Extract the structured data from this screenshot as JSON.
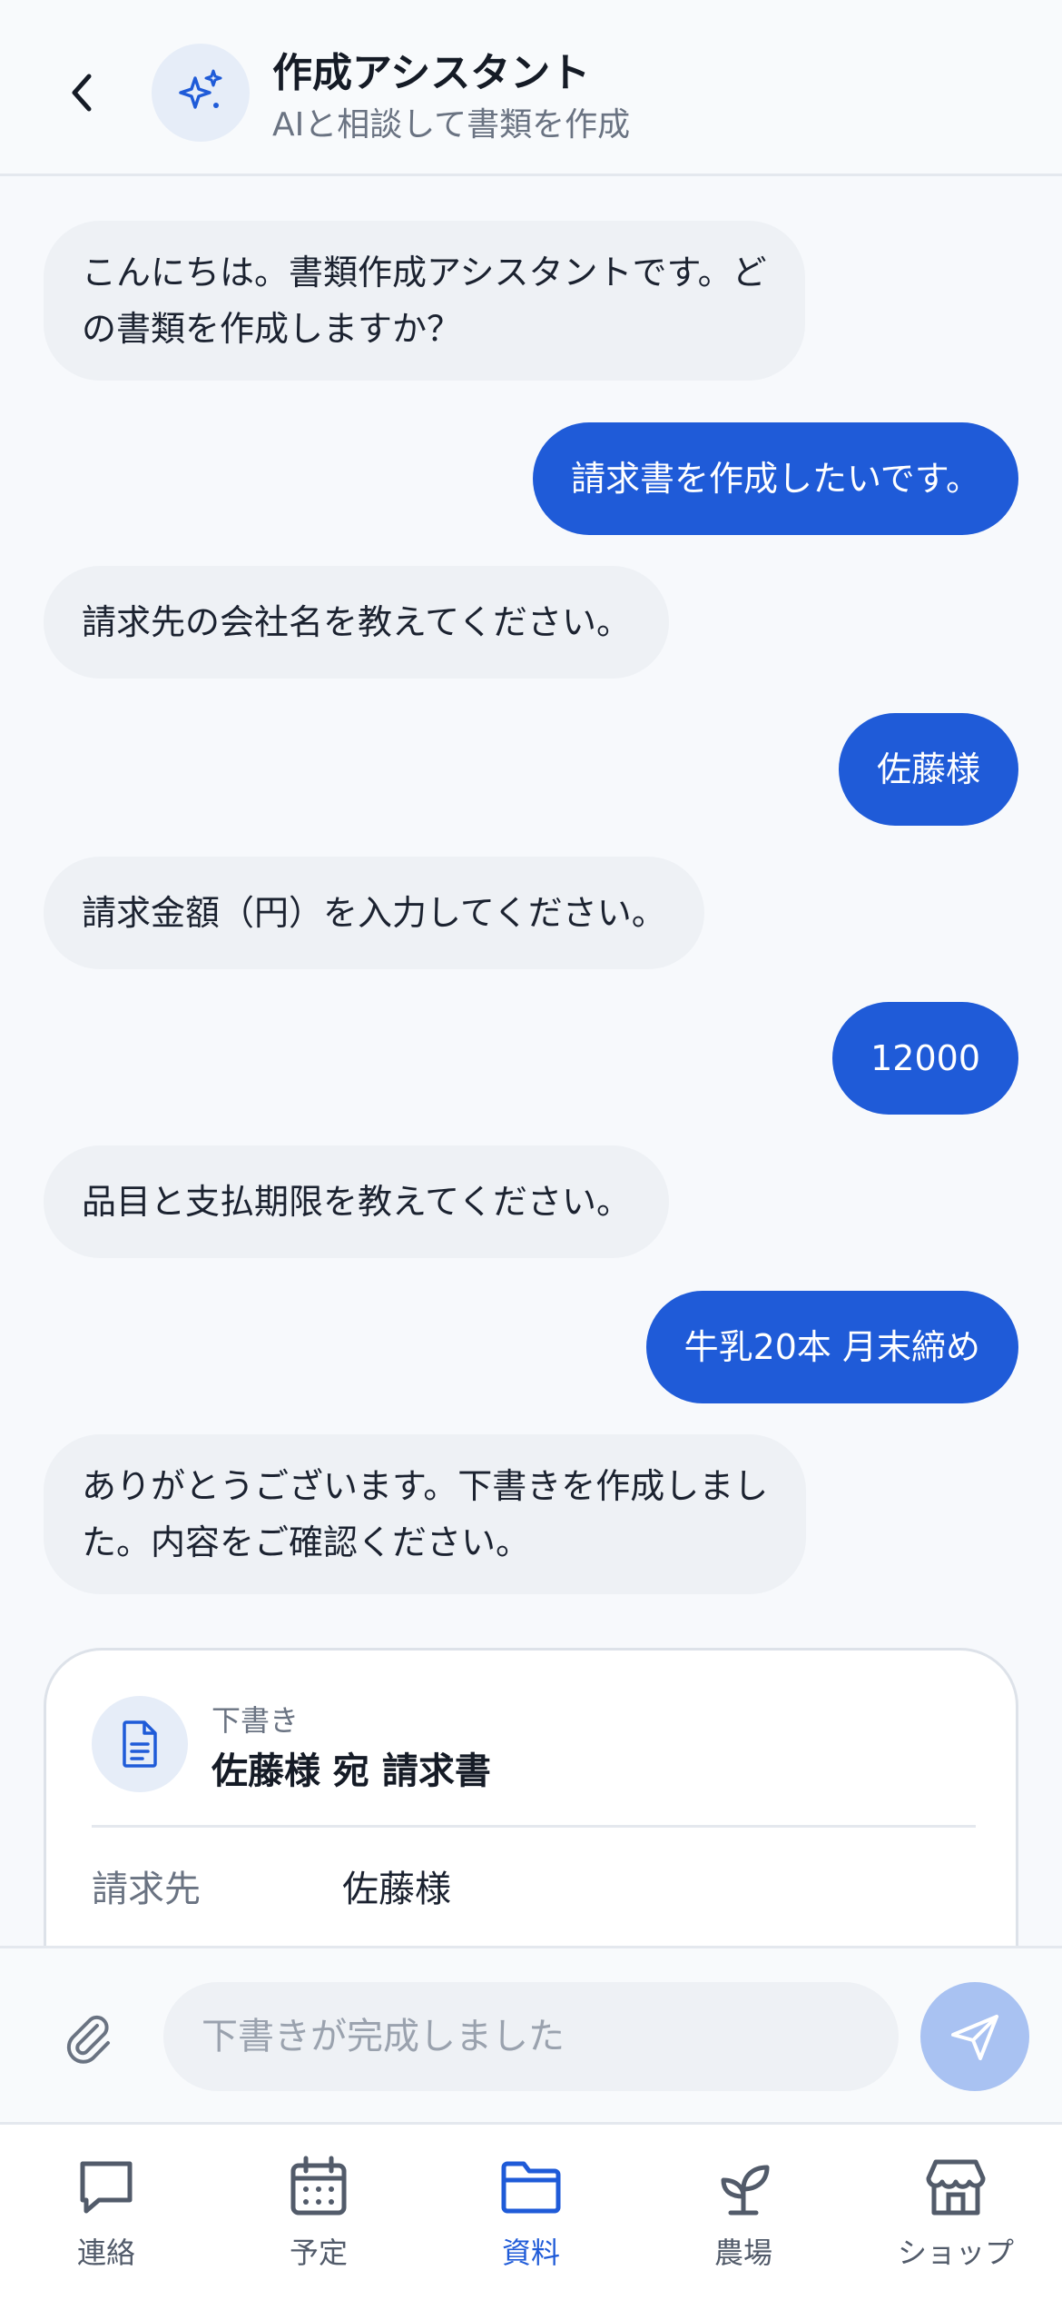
{
  "header": {
    "title": "作成アシスタント",
    "subtitle": "AIと相談して書類を作成",
    "back_icon": "chevron-left-icon",
    "avatar_icon": "sparkles-icon"
  },
  "messages": [
    {
      "role": "bot",
      "text_lines": [
        "こんにちは。書類作成アシスタントです。ど",
        "の書類を作成しますか？"
      ]
    },
    {
      "role": "user",
      "text": "請求書を作成したいです。"
    },
    {
      "role": "bot",
      "text": "請求先の会社名を教えてください。"
    },
    {
      "role": "user",
      "text": "佐藤様"
    },
    {
      "role": "bot",
      "text": "請求金額（円）を入力してください。"
    },
    {
      "role": "user",
      "text": "12000"
    },
    {
      "role": "bot",
      "text": "品目と支払期限を教えてください。"
    },
    {
      "role": "user",
      "text": "牛乳20本 月末締め"
    },
    {
      "role": "bot",
      "text_lines": [
        "ありがとうございます。下書きを作成しまし",
        "た。内容をご確認ください。"
      ]
    }
  ],
  "draft": {
    "label": "下書き",
    "title": "佐藤様 宛 請求書",
    "icon": "document-icon",
    "fields": [
      {
        "key": "請求先",
        "value": "佐藤様"
      }
    ]
  },
  "input": {
    "placeholder": "下書きが完成しました",
    "value": ""
  },
  "nav": [
    {
      "label": "連絡",
      "icon": "chat-icon",
      "active": false
    },
    {
      "label": "予定",
      "icon": "calendar-icon",
      "active": false
    },
    {
      "label": "資料",
      "icon": "folder-icon",
      "active": true
    },
    {
      "label": "農場",
      "icon": "sprout-icon",
      "active": false
    },
    {
      "label": "ショップ",
      "icon": "store-icon",
      "active": false
    }
  ],
  "colors": {
    "accent": "#1f5bd8",
    "bot_bubble": "#eef1f5",
    "send_disabled": "#a9c2f2"
  }
}
